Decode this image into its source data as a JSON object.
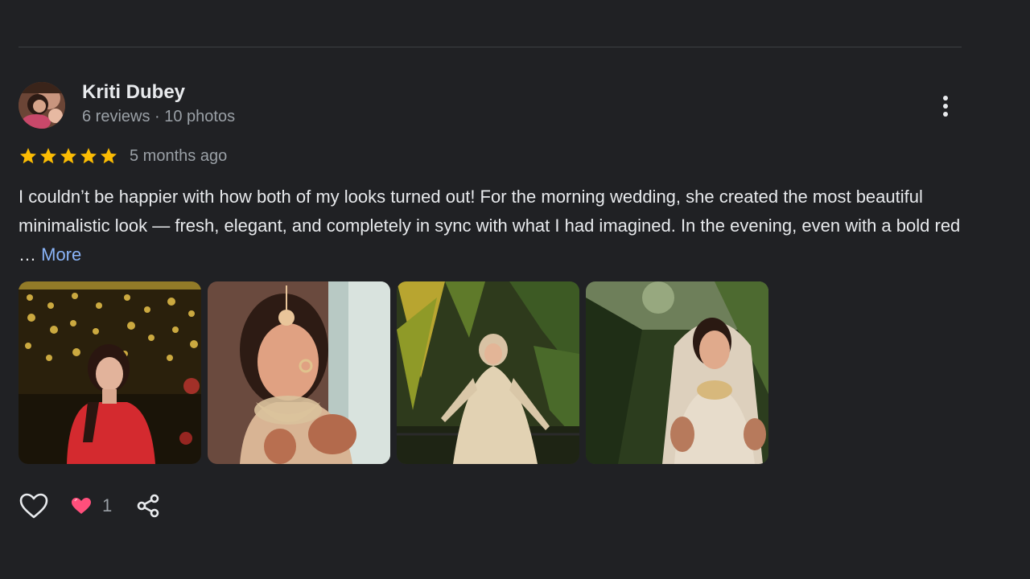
{
  "reviewer": {
    "name": "Kriti Dubey",
    "meta": "6 reviews · 10 photos"
  },
  "review": {
    "rating": 5,
    "time": "5 months ago",
    "text": "I couldn’t be happier with how both of my looks turned out! For the morning wedding, she created the most beautiful minimalistic look — fresh, elegant, and completely in sync with what I had imagined. In the evening, even with a bold red … ",
    "more_label": "More"
  },
  "photos": [
    {
      "alt": "photo-1"
    },
    {
      "alt": "photo-2"
    },
    {
      "alt": "photo-3"
    },
    {
      "alt": "photo-4"
    }
  ],
  "reactions": {
    "heart_count": "1"
  },
  "icons": {
    "menu": "more-vert-icon",
    "like": "heart-outline-icon",
    "reaction": "heart-filled-icon",
    "share": "share-icon"
  },
  "colors": {
    "background": "#202124",
    "star": "#fbbc04",
    "link": "#8ab4f8",
    "heart": "#ff4f7b"
  }
}
